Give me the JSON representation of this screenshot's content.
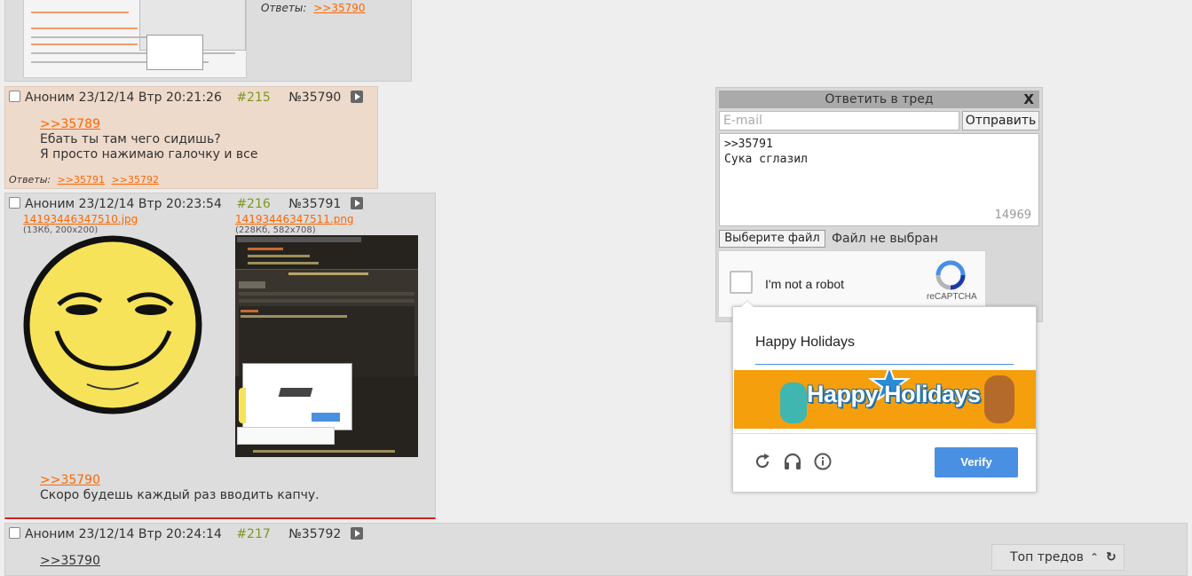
{
  "post_top": {
    "replies_label": "Ответы:",
    "reply_link": ">>35790"
  },
  "post_215": {
    "author": "Аноним",
    "date": "23/12/14 Втр 20:21:26",
    "num": "#215",
    "pno": "№35790",
    "quote": ">>35789",
    "lines": [
      "Ебать ты там чего сидишь?",
      "Я просто нажимаю галочку и все"
    ],
    "replies_label": "Ответы:",
    "replies": [
      ">>35791",
      ">>35792"
    ]
  },
  "post_216": {
    "author": "Аноним",
    "date": "23/12/14 Втр 20:23:54",
    "num": "#216",
    "pno": "№35791",
    "file1": {
      "name": "14193446347510.jpg",
      "meta": "(13Кб, 200x200)"
    },
    "file2": {
      "name": "14193446347511.png",
      "meta": "(228Кб, 582x708)"
    },
    "quote": ">>35790",
    "lines": [
      "Скоро будешь каждый раз вводить капчу."
    ]
  },
  "post_217": {
    "author": "Аноним",
    "date": "23/12/14 Втр 20:24:14",
    "num": "#217",
    "pno": "№35792",
    "quote": ">>35790"
  },
  "reply_form": {
    "title": "Ответить в тред",
    "close": "X",
    "email_placeholder": "E-mail",
    "send": "Отправить",
    "message": ">>35791\nСука сглазил",
    "counter": "14969",
    "file_button": "Выберите файл",
    "file_status": "Файл не выбран"
  },
  "recaptcha": {
    "label": "I'm not a robot",
    "brand": "reCAPTCHA",
    "answer": "Happy Holidays",
    "image_text": "Happy Holidays",
    "verify": "Verify"
  },
  "top_threads": {
    "label": "Топ тредов"
  },
  "colors": {
    "link": "#ff6600",
    "post_num": "#789922",
    "verify_bg": "#4a90e2",
    "banner_bg": "#f59f0d"
  }
}
